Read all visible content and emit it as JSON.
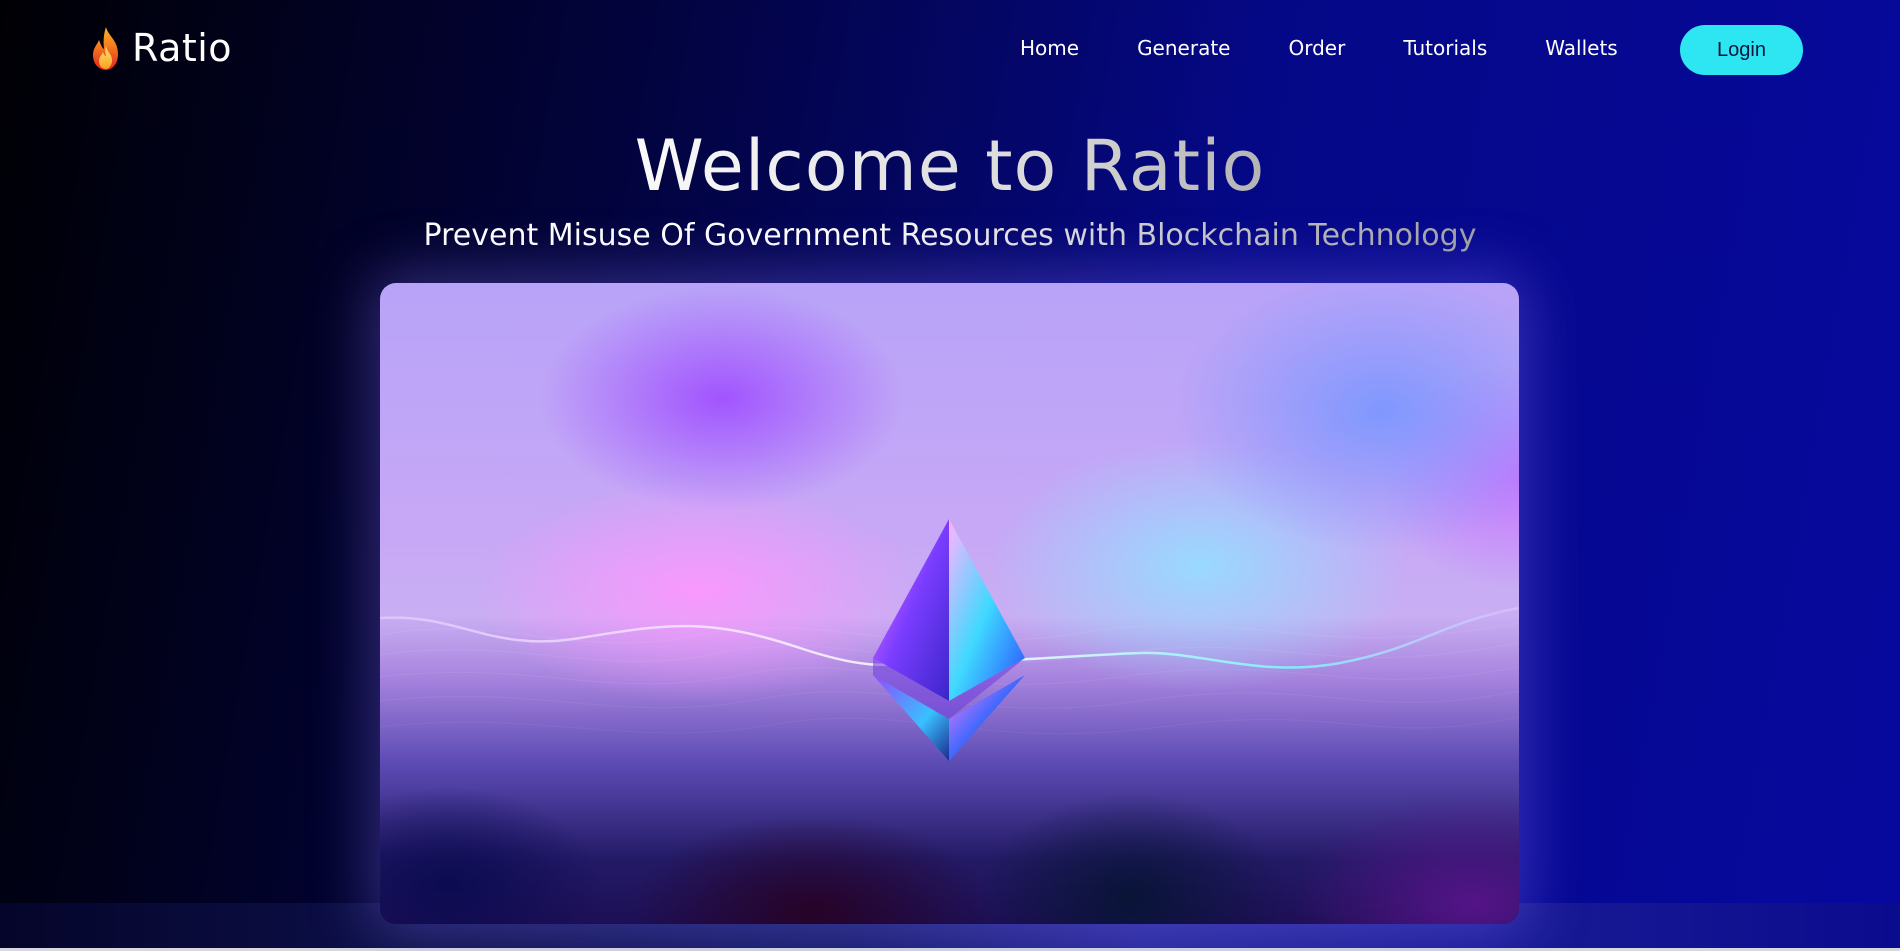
{
  "brand": {
    "name": "Ratio",
    "logo_icon": "flame-icon"
  },
  "nav": {
    "items": [
      {
        "label": "Home"
      },
      {
        "label": "Generate"
      },
      {
        "label": "Order"
      },
      {
        "label": "Tutorials"
      },
      {
        "label": "Wallets"
      }
    ],
    "login_label": "Login"
  },
  "hero": {
    "title": "Welcome to Ratio",
    "subtitle": "Prevent Misuse Of Government Resources with Blockchain Technology",
    "image_icon": "ethereum-diamond-icon"
  },
  "colors": {
    "accent": "#2ee6f2",
    "background_dark": "#000004",
    "background_blue": "#07099e"
  }
}
